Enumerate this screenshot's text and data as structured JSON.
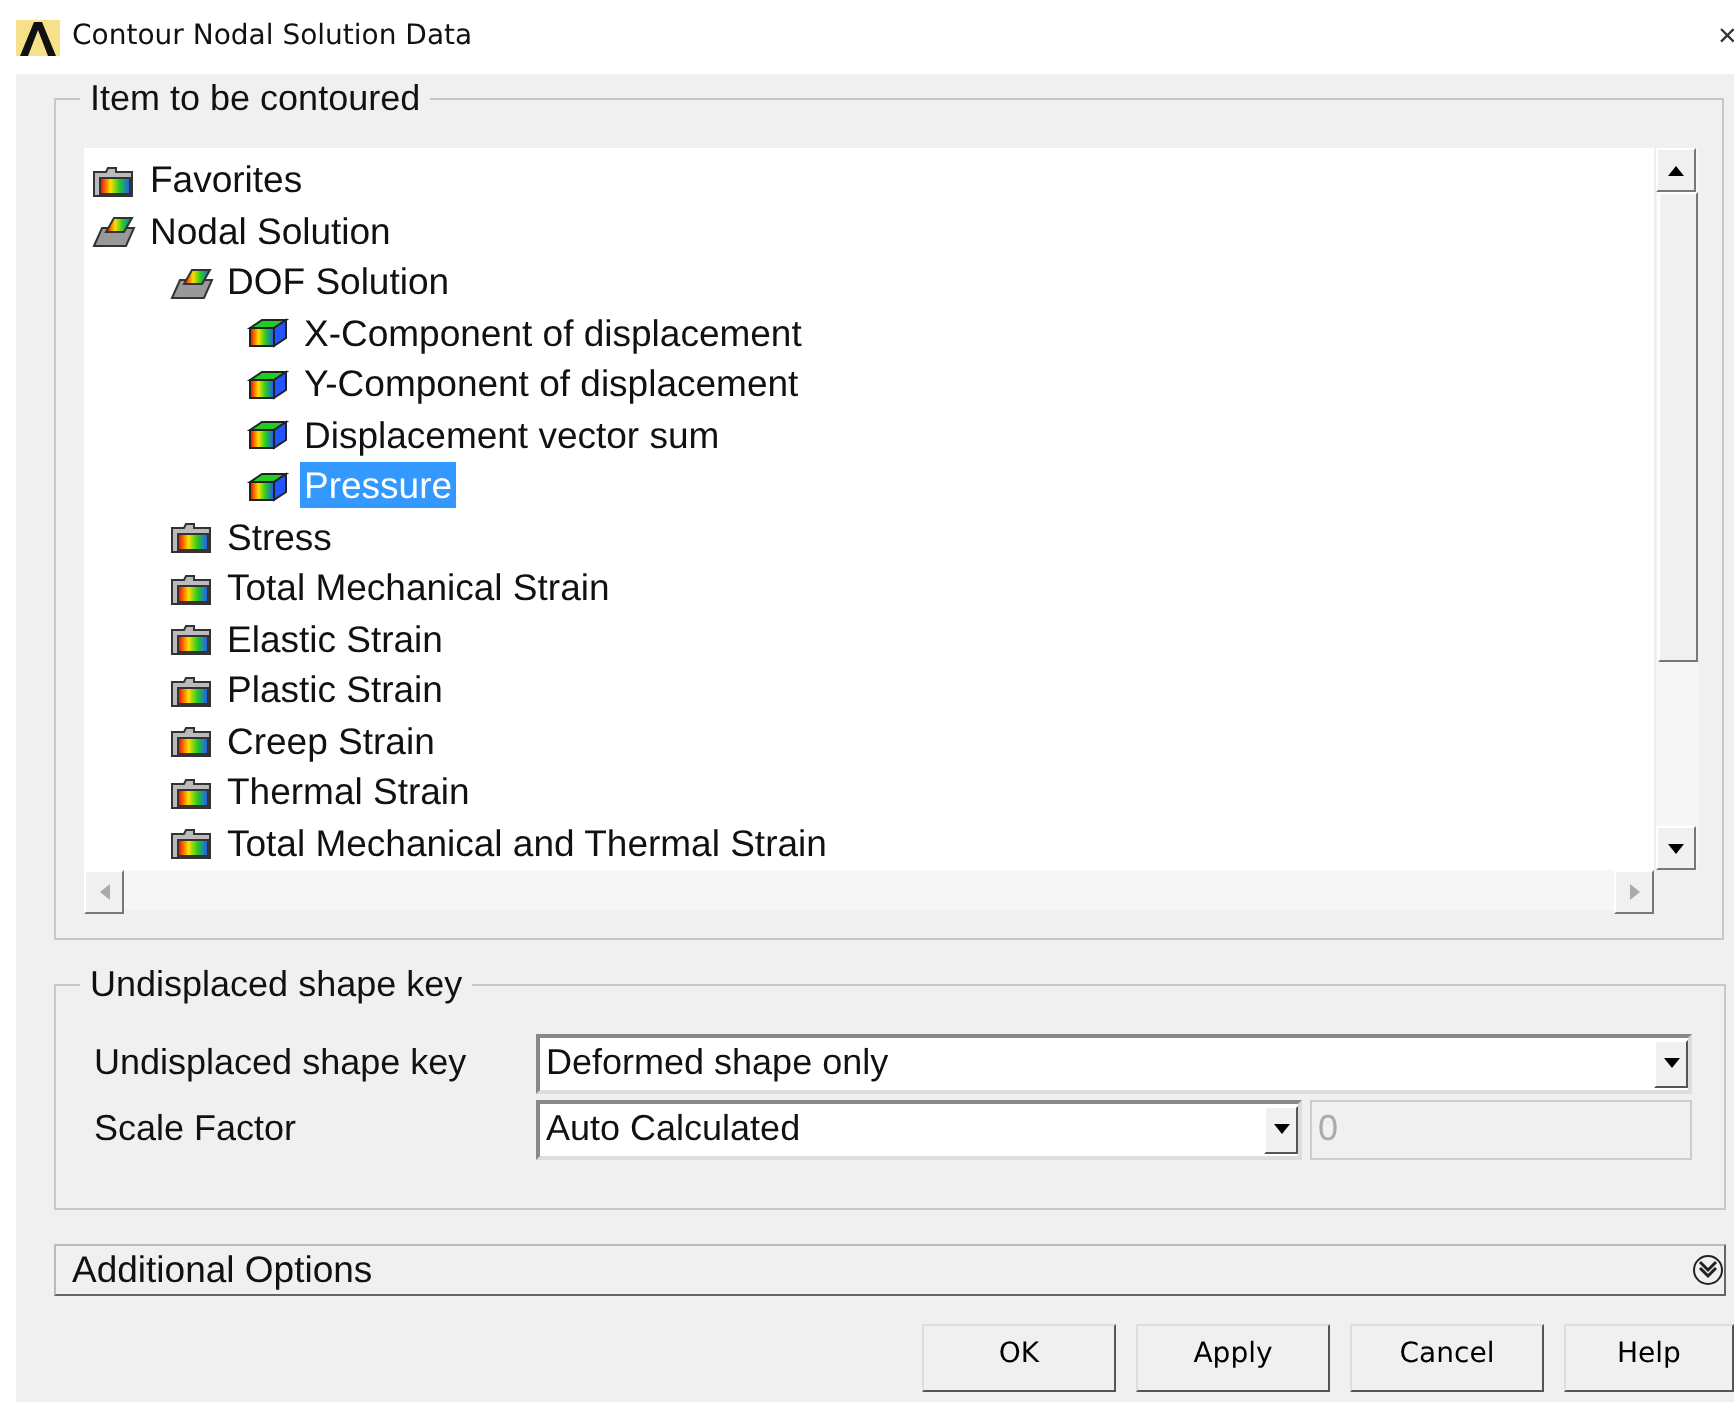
{
  "window": {
    "title": "Contour Nodal Solution Data",
    "close": "×"
  },
  "item_group": {
    "title": "Item to be contoured",
    "tree": [
      {
        "label": "Favorites",
        "kind": "folder",
        "expanded": false,
        "selected": false
      },
      {
        "label": "Nodal Solution",
        "kind": "folder",
        "expanded": true,
        "selected": false,
        "children": [
          {
            "label": "DOF Solution",
            "kind": "folder",
            "expanded": true,
            "selected": false,
            "children": [
              {
                "label": "X-Component of displacement",
                "kind": "item",
                "selected": false
              },
              {
                "label": "Y-Component of displacement",
                "kind": "item",
                "selected": false
              },
              {
                "label": "Displacement vector sum",
                "kind": "item",
                "selected": false
              },
              {
                "label": "Pressure",
                "kind": "item",
                "selected": true
              }
            ]
          },
          {
            "label": "Stress",
            "kind": "folder",
            "expanded": false,
            "selected": false
          },
          {
            "label": "Total Mechanical Strain",
            "kind": "folder",
            "expanded": false,
            "selected": false
          },
          {
            "label": "Elastic Strain",
            "kind": "folder",
            "expanded": false,
            "selected": false
          },
          {
            "label": "Plastic Strain",
            "kind": "folder",
            "expanded": false,
            "selected": false
          },
          {
            "label": "Creep Strain",
            "kind": "folder",
            "expanded": false,
            "selected": false
          },
          {
            "label": "Thermal Strain",
            "kind": "folder",
            "expanded": false,
            "selected": false
          },
          {
            "label": "Total Mechanical and Thermal Strain",
            "kind": "folder",
            "expanded": false,
            "selected": false
          }
        ]
      }
    ]
  },
  "shape_group": {
    "title": "Undisplaced shape key",
    "rows": [
      {
        "label": "Undisplaced shape key",
        "value": "Deformed shape only"
      },
      {
        "label": "Scale Factor",
        "value": "Auto Calculated",
        "extra_value": "0",
        "extra_disabled": true
      }
    ]
  },
  "additional_options": {
    "label": "Additional Options",
    "expanded": false
  },
  "buttons": [
    "OK",
    "Apply",
    "Cancel",
    "Help"
  ]
}
